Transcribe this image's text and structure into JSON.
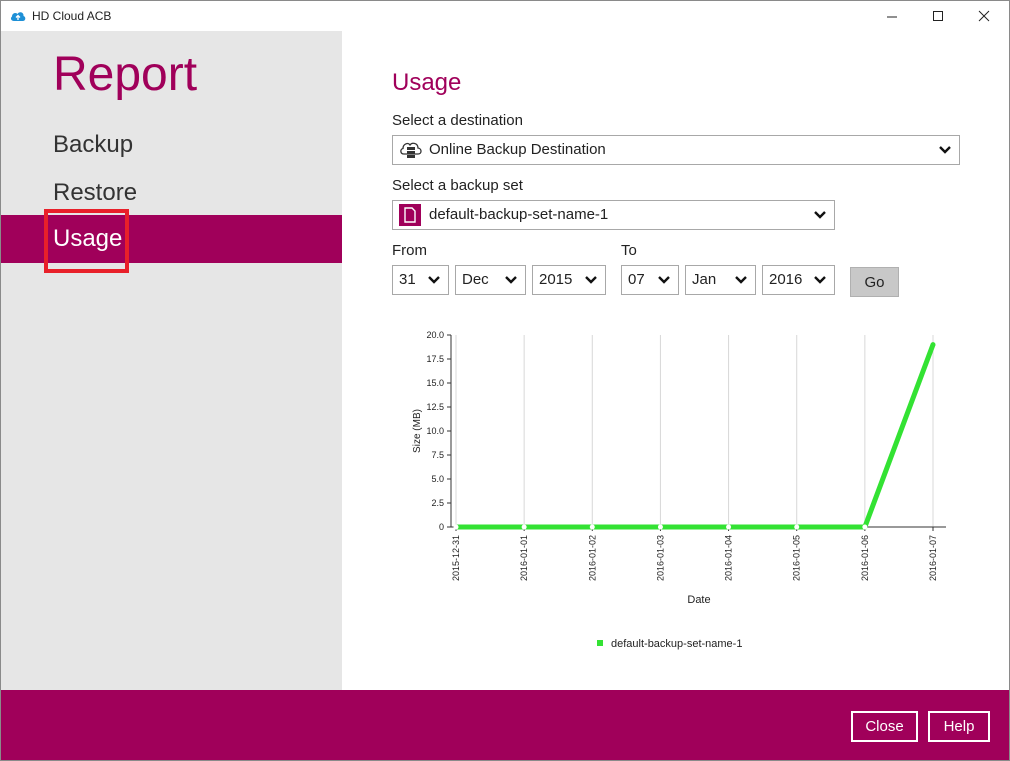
{
  "window": {
    "title": "HD Cloud ACB"
  },
  "sidebar": {
    "title": "Report",
    "items": [
      {
        "label": "Backup"
      },
      {
        "label": "Restore"
      },
      {
        "label": "Usage"
      }
    ]
  },
  "main": {
    "title": "Usage",
    "destination": {
      "label": "Select a destination",
      "value": "Online Backup Destination"
    },
    "backup_set": {
      "label": "Select a backup set",
      "value": "default-backup-set-name-1"
    },
    "from": {
      "label": "From",
      "day": "31",
      "month": "Dec",
      "year": "2015"
    },
    "to": {
      "label": "To",
      "day": "07",
      "month": "Jan",
      "year": "2016"
    },
    "go_label": "Go"
  },
  "footer": {
    "close_label": "Close",
    "help_label": "Help"
  },
  "colors": {
    "accent": "#a0005a",
    "series": "#33e233",
    "highlight": "#e8202a"
  },
  "chart_data": {
    "type": "line",
    "xlabel": "Date",
    "ylabel": "Size (MB)",
    "x": [
      "2015-12-31",
      "2016-01-01",
      "2016-01-02",
      "2016-01-03",
      "2016-01-04",
      "2016-01-05",
      "2016-01-06",
      "2016-01-07"
    ],
    "yticks": [
      "0",
      "2.5",
      "5.0",
      "7.5",
      "10.0",
      "12.5",
      "15.0",
      "17.5",
      "20.0"
    ],
    "ylim": [
      0,
      20
    ],
    "series": [
      {
        "name": "default-backup-set-name-1",
        "values": [
          0,
          0,
          0,
          0,
          0,
          0,
          0,
          19
        ]
      }
    ],
    "grid": "vertical",
    "legend": "bottom"
  }
}
